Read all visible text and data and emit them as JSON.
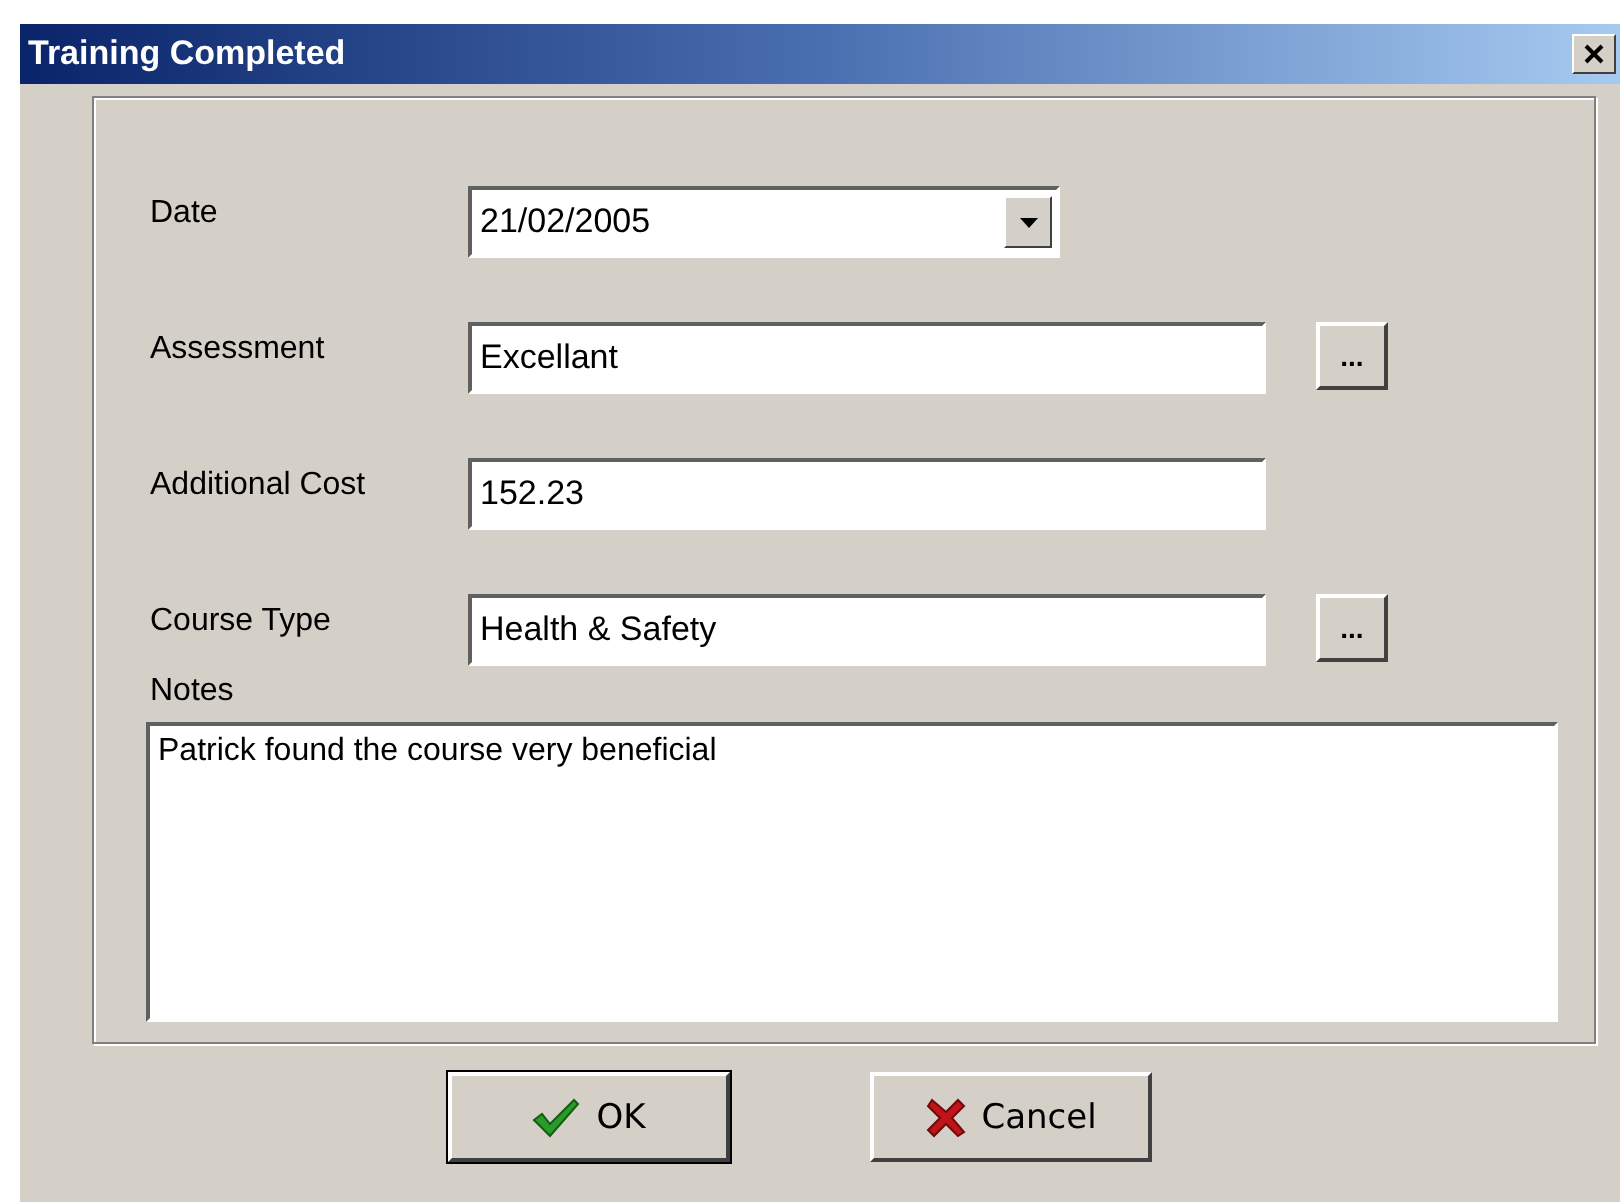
{
  "window": {
    "title": "Training Completed"
  },
  "fields": [
    {
      "kind": "dropdown",
      "label": "Date",
      "value": "21/02/2005"
    },
    {
      "kind": "lookup",
      "label": "Assessment",
      "value": "Excellant",
      "button": "..."
    },
    {
      "kind": "text",
      "label": "Additional Cost",
      "value": "152.23"
    },
    {
      "kind": "lookup",
      "label": "Course Type",
      "value": "Health & Safety",
      "button": "..."
    }
  ],
  "notes": {
    "label": "Notes",
    "value": "Patrick found the course very beneficial"
  },
  "buttons": [
    {
      "kind": "ok",
      "label": "OK",
      "selected": true
    },
    {
      "kind": "cancel",
      "label": "Cancel",
      "selected": false
    }
  ]
}
